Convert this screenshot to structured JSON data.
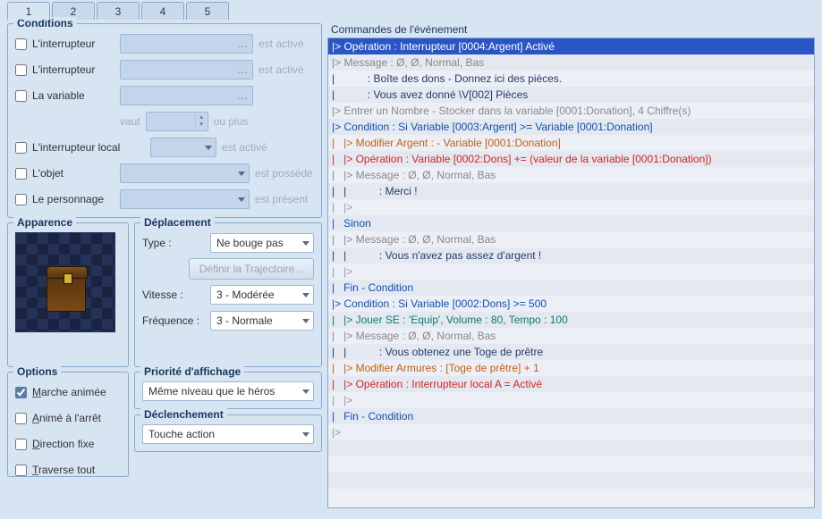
{
  "tabs": [
    "1",
    "2",
    "3",
    "4",
    "5"
  ],
  "active_tab": 0,
  "conditions": {
    "title": "Conditions",
    "switch1_label": "L'interrupteur",
    "switch2_label": "L'interrupteur",
    "variable_label": "La variable",
    "variable_equals": "vaut",
    "variable_or_more": "ou plus",
    "localswitch_label": "L'interrupteur local",
    "item_label": "L'objet",
    "actor_label": "Le personnage",
    "switch_suffix": "est activé",
    "item_suffix": "est possédé",
    "actor_suffix": "est présent",
    "ellipsis": "..."
  },
  "appearance": {
    "title": "Apparence"
  },
  "movement": {
    "title": "Déplacement",
    "type_label": "Type :",
    "type_value": "Ne bouge pas",
    "define_route": "Définir la Trajectoire...",
    "speed_label": "Vitesse :",
    "speed_value": "3 - Modérée",
    "freq_label": "Fréquence :",
    "freq_value": "3 - Normale"
  },
  "options": {
    "title": "Options",
    "walking_anim": "Marche animée",
    "stepping_anim": "Animé à l'arrêt",
    "dir_fix": "Direction fixe",
    "through": "Traverse tout"
  },
  "priority": {
    "title": "Priorité d'affichage",
    "value": "Même niveau que le héros"
  },
  "trigger": {
    "title": "Déclenchement",
    "value": "Touche action"
  },
  "commands": {
    "title": "Commandes de l'événement",
    "lines": [
      {
        "cls": "sel",
        "txt": "|> Opération : Interrupteur [0004:Argent] Activé"
      },
      {
        "cls": "c-grey",
        "txt": "|> Message : Ø, Ø, Normal, Bas"
      },
      {
        "cls": "c-darkblue",
        "txt": "|           : Boîte des dons - Donnez ici des pièces."
      },
      {
        "cls": "c-darkblue",
        "txt": "|           : Vous avez donné \\V[002] Pièces"
      },
      {
        "cls": "c-grey",
        "txt": "|> Entrer un Nombre - Stocker dans la variable [0001:Donation], 4 Chiffre(s)"
      },
      {
        "cls": "c-blue",
        "txt": "|> Condition : Si Variable [0003:Argent] >= Variable [0001:Donation]"
      },
      {
        "cls": "c-orange",
        "txt": "|   |> Modifier Argent : - Variable [0001:Donation]"
      },
      {
        "cls": "c-red",
        "txt": "|   |> Opération : Variable [0002:Dons] += (valeur de la variable [0001:Donation])"
      },
      {
        "cls": "c-grey",
        "txt": "|   |> Message : Ø, Ø, Normal, Bas"
      },
      {
        "cls": "c-darkblue",
        "txt": "|   |           : Merci !"
      },
      {
        "cls": "c-dim",
        "txt": "|   |>"
      },
      {
        "cls": "c-blue",
        "txt": "|   Sinon"
      },
      {
        "cls": "c-grey",
        "txt": "|   |> Message : Ø, Ø, Normal, Bas"
      },
      {
        "cls": "c-darkblue",
        "txt": "|   |           : Vous n'avez pas assez d'argent !"
      },
      {
        "cls": "c-dim",
        "txt": "|   |>"
      },
      {
        "cls": "c-blue",
        "txt": "|   Fin - Condition"
      },
      {
        "cls": "c-blue",
        "txt": "|> Condition : Si Variable [0002:Dons] >= 500"
      },
      {
        "cls": "c-teal",
        "txt": "|   |> Jouer SE : 'Equip', Volume : 80, Tempo : 100"
      },
      {
        "cls": "c-grey",
        "txt": "|   |> Message : Ø, Ø, Normal, Bas"
      },
      {
        "cls": "c-darkblue",
        "txt": "|   |           : Vous obtenez une Toge de prêtre"
      },
      {
        "cls": "c-orange",
        "txt": "|   |> Modifier Armures : [Toge de prêtre] + 1"
      },
      {
        "cls": "c-red",
        "txt": "|   |> Opération : Interrupteur local A = Activé"
      },
      {
        "cls": "c-dim",
        "txt": "|   |>"
      },
      {
        "cls": "c-blue",
        "txt": "|   Fin - Condition"
      },
      {
        "cls": "c-dim",
        "txt": "|>"
      },
      {
        "cls": "",
        "txt": " "
      },
      {
        "cls": "",
        "txt": " "
      },
      {
        "cls": "",
        "txt": " "
      },
      {
        "cls": "",
        "txt": " "
      }
    ]
  }
}
